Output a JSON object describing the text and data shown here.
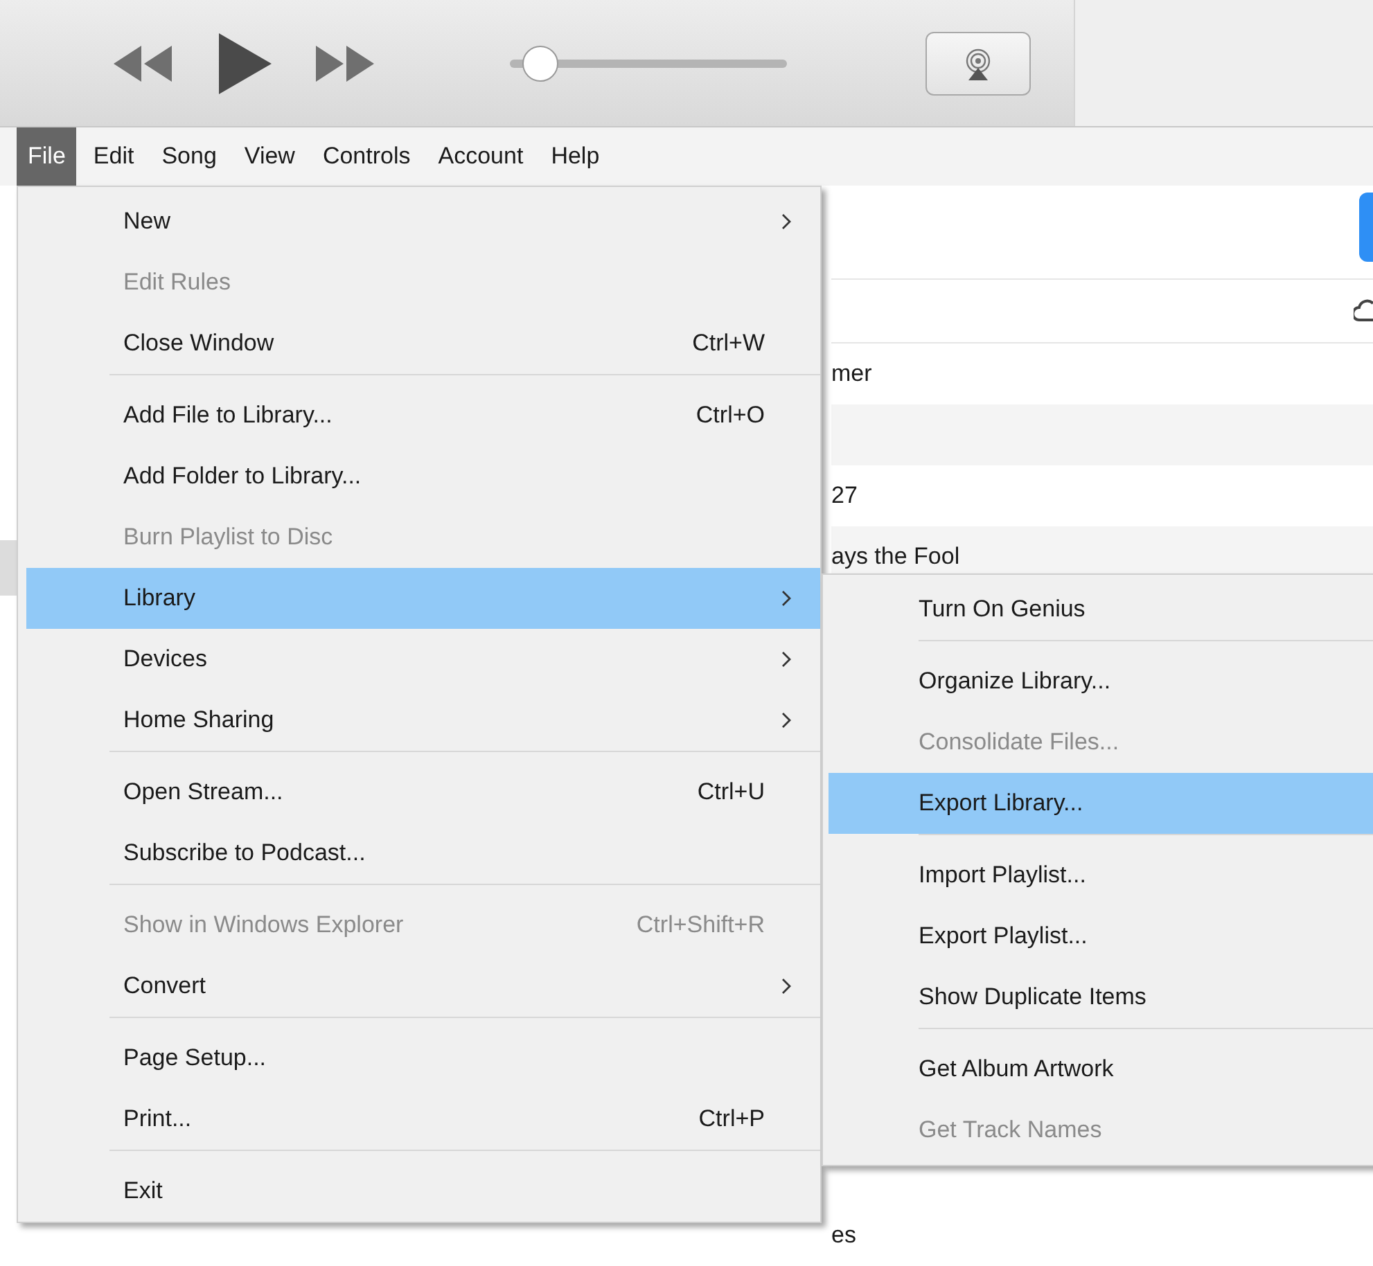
{
  "volume": {
    "level": 0.05
  },
  "menubar": [
    {
      "label": "File",
      "selected": true
    },
    {
      "label": "Edit",
      "selected": false
    },
    {
      "label": "Song",
      "selected": false
    },
    {
      "label": "View",
      "selected": false
    },
    {
      "label": "Controls",
      "selected": false
    },
    {
      "label": "Account",
      "selected": false
    },
    {
      "label": "Help",
      "selected": false
    }
  ],
  "list_rows": [
    {
      "title": "mer"
    },
    {},
    {
      "title": "27"
    },
    {
      "title": "ays the Fool"
    }
  ],
  "last_row": {
    "title": "es"
  },
  "file_menu": [
    [
      {
        "label": "New",
        "submenu": true,
        "disabled": false,
        "selected": false
      },
      {
        "label": "Edit Rules",
        "submenu": false,
        "disabled": true,
        "selected": false
      },
      {
        "label": "Close Window",
        "shortcut": "Ctrl+W",
        "submenu": false,
        "disabled": false,
        "selected": false
      }
    ],
    [
      {
        "label": "Add File to Library...",
        "shortcut": "Ctrl+O",
        "submenu": false,
        "disabled": false,
        "selected": false
      },
      {
        "label": "Add Folder to Library...",
        "submenu": false,
        "disabled": false,
        "selected": false
      },
      {
        "label": "Burn Playlist to Disc",
        "submenu": false,
        "disabled": true,
        "selected": false
      },
      {
        "label": "Library",
        "submenu": true,
        "disabled": false,
        "selected": true
      },
      {
        "label": "Devices",
        "submenu": true,
        "disabled": false,
        "selected": false
      },
      {
        "label": "Home Sharing",
        "submenu": true,
        "disabled": false,
        "selected": false
      }
    ],
    [
      {
        "label": "Open Stream...",
        "shortcut": "Ctrl+U",
        "submenu": false,
        "disabled": false,
        "selected": false
      },
      {
        "label": "Subscribe to Podcast...",
        "submenu": false,
        "disabled": false,
        "selected": false
      }
    ],
    [
      {
        "label": "Show in Windows Explorer",
        "shortcut": "Ctrl+Shift+R",
        "submenu": false,
        "disabled": true,
        "selected": false
      },
      {
        "label": "Convert",
        "submenu": true,
        "disabled": false,
        "selected": false
      }
    ],
    [
      {
        "label": "Page Setup...",
        "submenu": false,
        "disabled": false,
        "selected": false
      },
      {
        "label": "Print...",
        "shortcut": "Ctrl+P",
        "submenu": false,
        "disabled": false,
        "selected": false
      }
    ],
    [
      {
        "label": "Exit",
        "submenu": false,
        "disabled": false,
        "selected": false
      }
    ]
  ],
  "library_submenu": [
    [
      {
        "label": "Turn On Genius",
        "disabled": false,
        "selected": false
      }
    ],
    [
      {
        "label": "Organize Library...",
        "disabled": false,
        "selected": false
      },
      {
        "label": "Consolidate Files...",
        "disabled": true,
        "selected": false
      },
      {
        "label": "Export Library...",
        "disabled": false,
        "selected": true
      }
    ],
    [
      {
        "label": "Import Playlist...",
        "disabled": false,
        "selected": false
      },
      {
        "label": "Export Playlist...",
        "disabled": false,
        "selected": false
      },
      {
        "label": "Show Duplicate Items",
        "disabled": false,
        "selected": false
      }
    ],
    [
      {
        "label": "Get Album Artwork",
        "disabled": false,
        "selected": false
      },
      {
        "label": "Get Track Names",
        "disabled": true,
        "selected": false
      }
    ]
  ]
}
